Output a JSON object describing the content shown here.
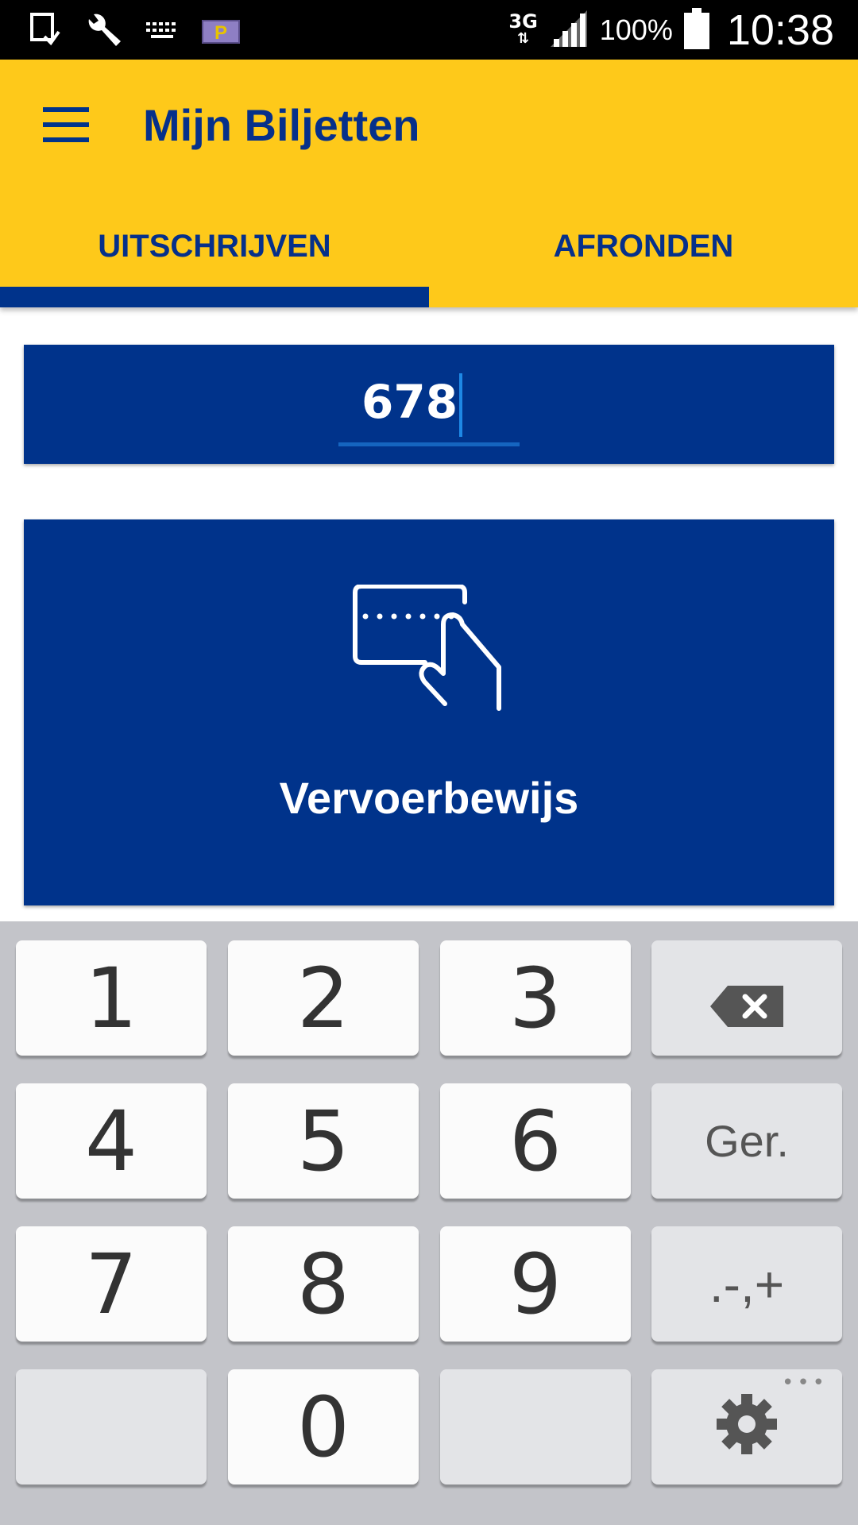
{
  "status_bar": {
    "network": "3G",
    "battery_percent": "100%",
    "time": "10:38",
    "icons": [
      "screenshot-icon",
      "wrench-icon",
      "keyboard-icon",
      "parking-icon",
      "signal-icon",
      "battery-icon"
    ],
    "parking_letter": "P"
  },
  "app_bar": {
    "title": "Mijn Biljetten",
    "menu_icon": "hamburger-menu-icon",
    "background": "#fec91a",
    "accent": "#00338b"
  },
  "tabs": [
    {
      "label": "UITSCHRIJVEN",
      "selected": true
    },
    {
      "label": "AFRONDEN",
      "selected": false
    }
  ],
  "number_input": {
    "value": "678"
  },
  "ticket_button": {
    "label": "Vervoerbewijs",
    "icon": "card-tap-icon"
  },
  "keyboard": {
    "rows": [
      [
        "1",
        "2",
        "3",
        "backspace"
      ],
      [
        "4",
        "5",
        "6",
        "Ger."
      ],
      [
        "7",
        "8",
        "9",
        ".-,+"
      ],
      [
        "",
        "0",
        "",
        "settings"
      ]
    ],
    "backspace_icon": "backspace-icon",
    "settings_icon": "gear-icon"
  }
}
